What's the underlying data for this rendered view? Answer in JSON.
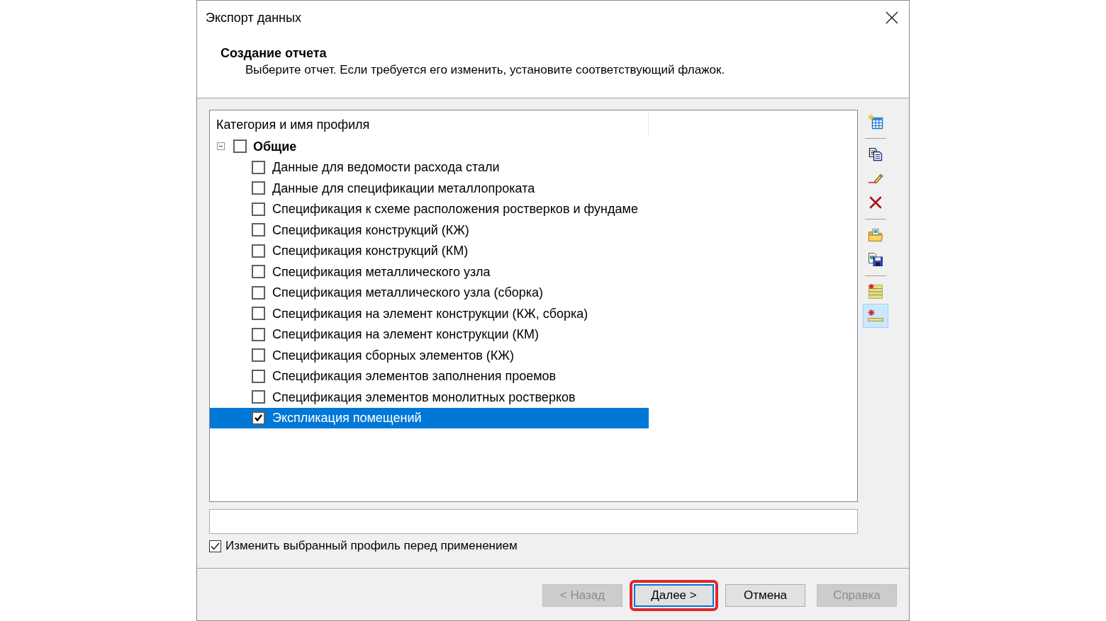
{
  "window": {
    "title": "Экспорт данных"
  },
  "header": {
    "title": "Создание отчета",
    "subtitle": "Выберите отчет. Если требуется его изменить, установите соответствующий флажок."
  },
  "tree": {
    "column": "Категория и имя профиля",
    "items": [
      {
        "label": "Общие",
        "checked": false,
        "expanded": true,
        "selected": false,
        "children": [
          {
            "label": "Данные для ведомости расхода стали",
            "checked": false,
            "selected": false
          },
          {
            "label": "Данные для спецификации металлопроката",
            "checked": false,
            "selected": false
          },
          {
            "label": "Спецификация к схеме расположения ростверков и фундаме",
            "checked": false,
            "selected": false
          },
          {
            "label": "Спецификация конструкций (КЖ)",
            "checked": false,
            "selected": false
          },
          {
            "label": "Спецификация конструкций (КМ)",
            "checked": false,
            "selected": false
          },
          {
            "label": "Спецификация металлического узла",
            "checked": false,
            "selected": false
          },
          {
            "label": "Спецификация металлического узла (сборка)",
            "checked": false,
            "selected": false
          },
          {
            "label": "Спецификация на элемент конструкции (КЖ, сборка)",
            "checked": false,
            "selected": false
          },
          {
            "label": "Спецификация на элемент конструкции (КМ)",
            "checked": false,
            "selected": false
          },
          {
            "label": "Спецификация сборных элементов (КЖ)",
            "checked": false,
            "selected": false
          },
          {
            "label": "Спецификация элементов заполнения проемов",
            "checked": false,
            "selected": false
          },
          {
            "label": "Спецификация элементов монолитных ростверков",
            "checked": false,
            "selected": false
          },
          {
            "label": "Экспликация помещений",
            "checked": true,
            "selected": true
          }
        ]
      }
    ]
  },
  "toolbar": [
    {
      "kind": "new_table",
      "pressed": false
    },
    {
      "kind": "separator"
    },
    {
      "kind": "copy",
      "pressed": false
    },
    {
      "kind": "rename",
      "pressed": false
    },
    {
      "kind": "delete",
      "pressed": false
    },
    {
      "kind": "separator"
    },
    {
      "kind": "open",
      "pressed": false
    },
    {
      "kind": "save",
      "pressed": false
    },
    {
      "kind": "separator"
    },
    {
      "kind": "list_all",
      "pressed": false
    },
    {
      "kind": "list_one",
      "pressed": true
    }
  ],
  "option": {
    "label": "Изменить выбранный профиль перед применением",
    "checked": true
  },
  "buttons": [
    {
      "label": "< Назад",
      "disabled": true,
      "default": false,
      "highlighted": false
    },
    {
      "label": "Далее >",
      "disabled": false,
      "default": true,
      "highlighted": true
    },
    {
      "label": "Отмена",
      "disabled": false,
      "default": false,
      "highlighted": false
    },
    {
      "label": "Справка",
      "disabled": true,
      "default": false,
      "highlighted": false
    }
  ]
}
